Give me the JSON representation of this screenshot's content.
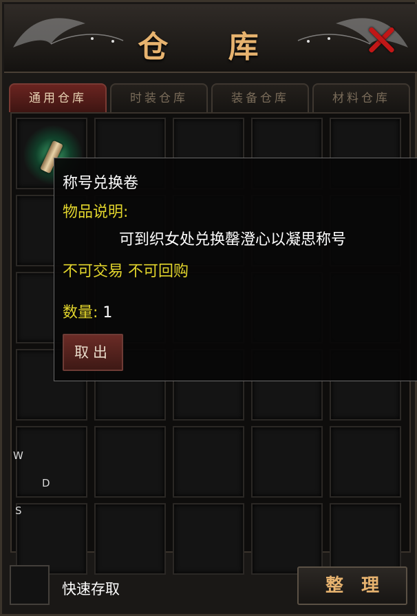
{
  "window": {
    "title": "仓 库"
  },
  "tabs": [
    {
      "label": "通用仓库"
    },
    {
      "label": "时装仓库"
    },
    {
      "label": "装备仓库"
    },
    {
      "label": "材料仓库"
    }
  ],
  "active_tab": 0,
  "grid": {
    "rows": 6,
    "cols": 5
  },
  "tooltip": {
    "item_name": "称号兑换卷",
    "desc_label": "物品说明:",
    "desc_text": "可到织女处兑换罄澄心以凝思称号",
    "trade_info": "不可交易 不可回购",
    "qty_label": "数量:",
    "qty_value": "1",
    "take_button": "取出"
  },
  "wasd": {
    "w": "W",
    "d": "D",
    "s": "S"
  },
  "bottom": {
    "quick_label": "快速存取",
    "sort_button": "整理"
  },
  "colors": {
    "title": "#e7b36f",
    "highlight": "#e2d52c",
    "close": "#c11717",
    "active_tab": "#6a2420"
  }
}
